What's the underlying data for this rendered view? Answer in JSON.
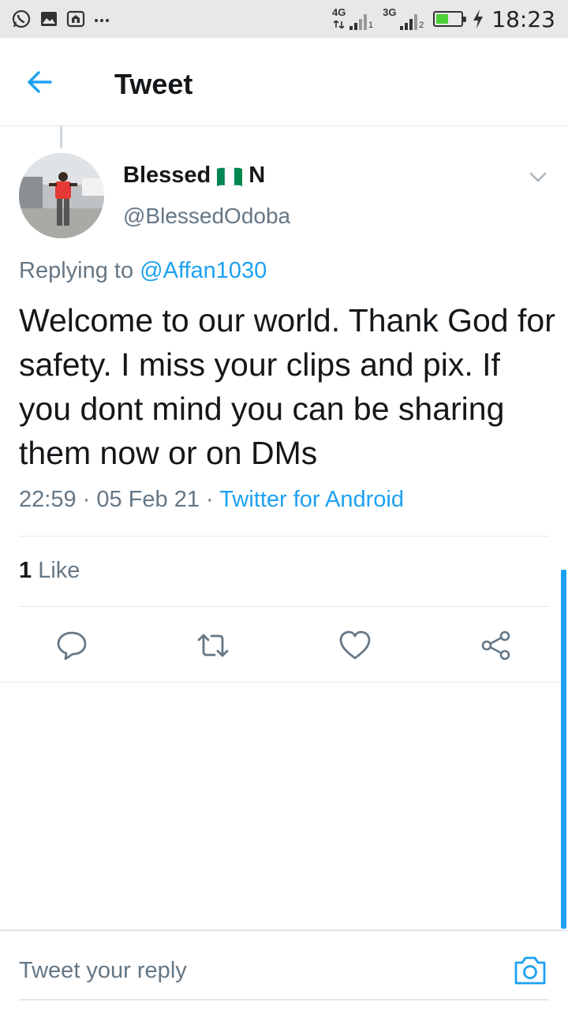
{
  "status_bar": {
    "time": "18:23",
    "network_1": "4G",
    "sim_1": "1",
    "network_2": "3G",
    "sim_2": "2",
    "battery_level": 0.5,
    "notification_icons": [
      "whatsapp-icon",
      "gallery-icon",
      "camera-icon",
      "more-dots-icon"
    ]
  },
  "header": {
    "title": "Tweet"
  },
  "tweet": {
    "author_name": "Blessed",
    "author_suffix": "N",
    "handle": "@BlessedOdoba",
    "replying_prefix": "Replying to",
    "replying_to": "@Affan1030",
    "text": "Welcome to our world. Thank God for safety. I miss your clips and pix. If you dont mind you can be sharing them now or on DMs",
    "time": "22:59",
    "date": "05 Feb 21",
    "separator": "·",
    "client": "Twitter for Android",
    "like_count": "1",
    "like_label": "Like"
  },
  "actions": [
    "reply-icon",
    "retweet-icon",
    "like-icon",
    "share-icon"
  ],
  "reply_bar": {
    "placeholder": "Tweet your reply"
  },
  "colors": {
    "accent": "#1da1f2",
    "secondary_text": "#657786",
    "primary_text": "#14171a",
    "divider": "#e1e8ed"
  }
}
